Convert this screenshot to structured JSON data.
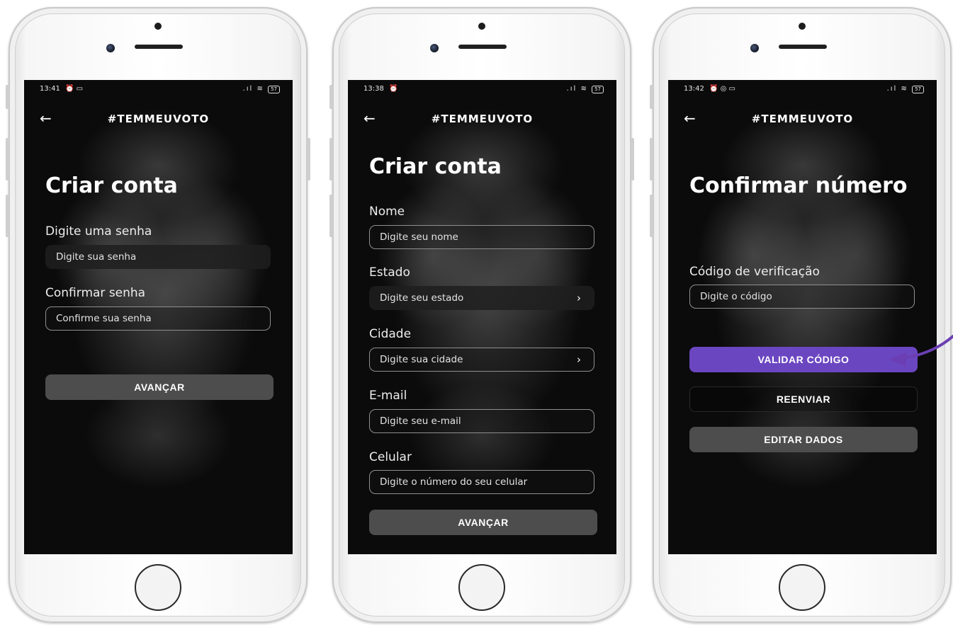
{
  "app": {
    "brand": "#TEMMEUVOTO",
    "back_icon": "arrow-left-icon"
  },
  "colors": {
    "accent_purple": "#6b46c1",
    "button_gray": "#4d4d4d",
    "arrow": "#6b3fb3"
  },
  "screens": [
    {
      "status": {
        "time": "13:41",
        "battery": "57"
      },
      "title": "Criar conta",
      "fields": [
        {
          "label": "Digite uma senha",
          "placeholder": "Digite sua senha"
        },
        {
          "label": "Confirmar senha",
          "placeholder": "Confirme sua senha"
        }
      ],
      "buttons": [
        {
          "label": "AVANÇAR"
        }
      ]
    },
    {
      "status": {
        "time": "13:38",
        "battery": "57"
      },
      "title": "Criar conta",
      "fields": [
        {
          "label": "Nome",
          "placeholder": "Digite seu nome"
        },
        {
          "label": "Estado",
          "placeholder": "Digite seu estado"
        },
        {
          "label": "Cidade",
          "placeholder": "Digite sua cidade"
        },
        {
          "label": "E-mail",
          "placeholder": "Digite seu e-mail"
        },
        {
          "label": "Celular",
          "placeholder": "Digite o número do seu celular"
        }
      ],
      "buttons": [
        {
          "label": "AVANÇAR"
        }
      ]
    },
    {
      "status": {
        "time": "13:42",
        "battery": "57"
      },
      "title": "Confirmar número",
      "fields": [
        {
          "label": "Código de verificação",
          "placeholder": "Digite o código"
        }
      ],
      "buttons": [
        {
          "label": "VALIDAR CÓDIGO"
        },
        {
          "label": "REENVIAR"
        },
        {
          "label": "EDITAR DADOS"
        }
      ]
    }
  ]
}
